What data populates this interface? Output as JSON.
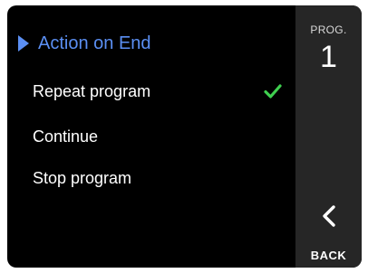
{
  "menu": {
    "title": "Action on End",
    "options": [
      {
        "label": "Repeat program",
        "selected": true
      },
      {
        "label": "Continue",
        "selected": false
      },
      {
        "label": "Stop program",
        "selected": false
      }
    ]
  },
  "sidebar": {
    "prog_label": "PROG.",
    "prog_number": "1",
    "back_label": "BACK"
  },
  "icons": {
    "title_marker": "caret-right-icon",
    "selected_marker": "checkmark-icon",
    "back": "chevron-left-icon"
  },
  "colors": {
    "accent": "#5b8ff3",
    "check": "#3fcf4f",
    "screen_bg": "#000000",
    "sidebar_bg": "#262626"
  }
}
